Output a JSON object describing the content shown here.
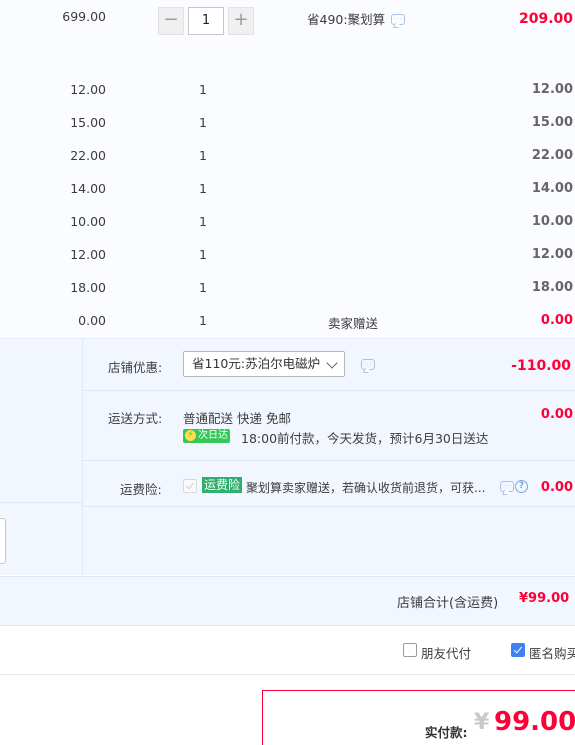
{
  "items": {
    "first": {
      "price": "699.00",
      "quantity": "1",
      "discount_text": "省490:聚划算",
      "subtotal": "209.00"
    },
    "rows": [
      {
        "price": "12.00",
        "quantity": "1",
        "note": "",
        "subtotal": "12.00"
      },
      {
        "price": "15.00",
        "quantity": "1",
        "note": "",
        "subtotal": "15.00"
      },
      {
        "price": "22.00",
        "quantity": "1",
        "note": "",
        "subtotal": "22.00"
      },
      {
        "price": "14.00",
        "quantity": "1",
        "note": "",
        "subtotal": "14.00"
      },
      {
        "price": "10.00",
        "quantity": "1",
        "note": "",
        "subtotal": "10.00"
      },
      {
        "price": "12.00",
        "quantity": "1",
        "note": "",
        "subtotal": "12.00"
      },
      {
        "price": "18.00",
        "quantity": "1",
        "note": "",
        "subtotal": "18.00"
      },
      {
        "price": "0.00",
        "quantity": "1",
        "note": "卖家赠送",
        "subtotal": "0.00"
      }
    ],
    "stepper": {
      "minus": "−",
      "plus": "+"
    }
  },
  "shop": {
    "coupon_label": "店铺优惠:",
    "coupon_selected": "省110元:苏泊尔电磁炉",
    "coupon_amount": "-110.00",
    "shipping_label": "运送方式:",
    "shipping_method": "普通配送 快递 免邮",
    "next_day_badge": "次日达",
    "shipping_note": "18:00前付款，今天发货，预计6月30日送达",
    "shipping_amount": "0.00",
    "insurance_label": "运费险:",
    "insurance_badge": "运费险",
    "insurance_text": "聚划算卖家赠送，若确认收货前退货，可获...",
    "insurance_amount": "0.00",
    "help_glyph": "?",
    "bolt_glyph": "⚡"
  },
  "total": {
    "label": "店铺合计(含运费)",
    "amount": "¥99.00"
  },
  "options": {
    "friend_pay": "朋友代付",
    "anonymous": "匿名购买",
    "anonymous_checked": true
  },
  "pay": {
    "label": "实付款:",
    "currency": "¥",
    "amount": "99.00"
  },
  "colors": {
    "accent_red": "#ff0036",
    "checkbox_blue": "#3b82f6",
    "next_day_green": "#35c859",
    "insurance_green": "#2fae6e"
  }
}
